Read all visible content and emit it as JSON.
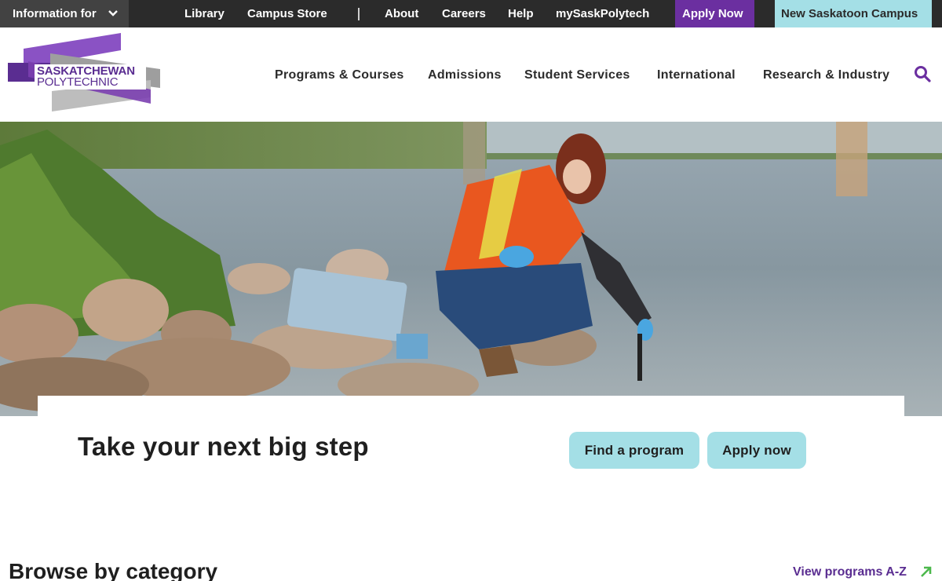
{
  "topbar": {
    "info_for": "Information for",
    "links": [
      "Library",
      "Campus Store",
      "About",
      "Careers",
      "Help",
      "mySaskPolytech"
    ],
    "apply_now": "Apply Now",
    "new_campus": "New Saskatoon Campus"
  },
  "logo": {
    "line1": "SASKATCHEWAN",
    "line2": "POLYTECHNIC"
  },
  "nav": [
    "Programs & Courses",
    "Admissions",
    "Student Services",
    "International",
    "Research & Industry"
  ],
  "hero": {
    "headline": "Take your next big step",
    "find_program": "Find a program",
    "apply_now": "Apply now"
  },
  "browse": {
    "title": "Browse by category",
    "view_all": "View programs A-Z"
  },
  "colors": {
    "brand_purple": "#6b2fa0",
    "accent_teal": "#a4dfe6",
    "topbar": "#2b2b2b"
  },
  "icons": [
    "chevron-down-icon",
    "search-icon",
    "arrow-up-right-icon"
  ]
}
